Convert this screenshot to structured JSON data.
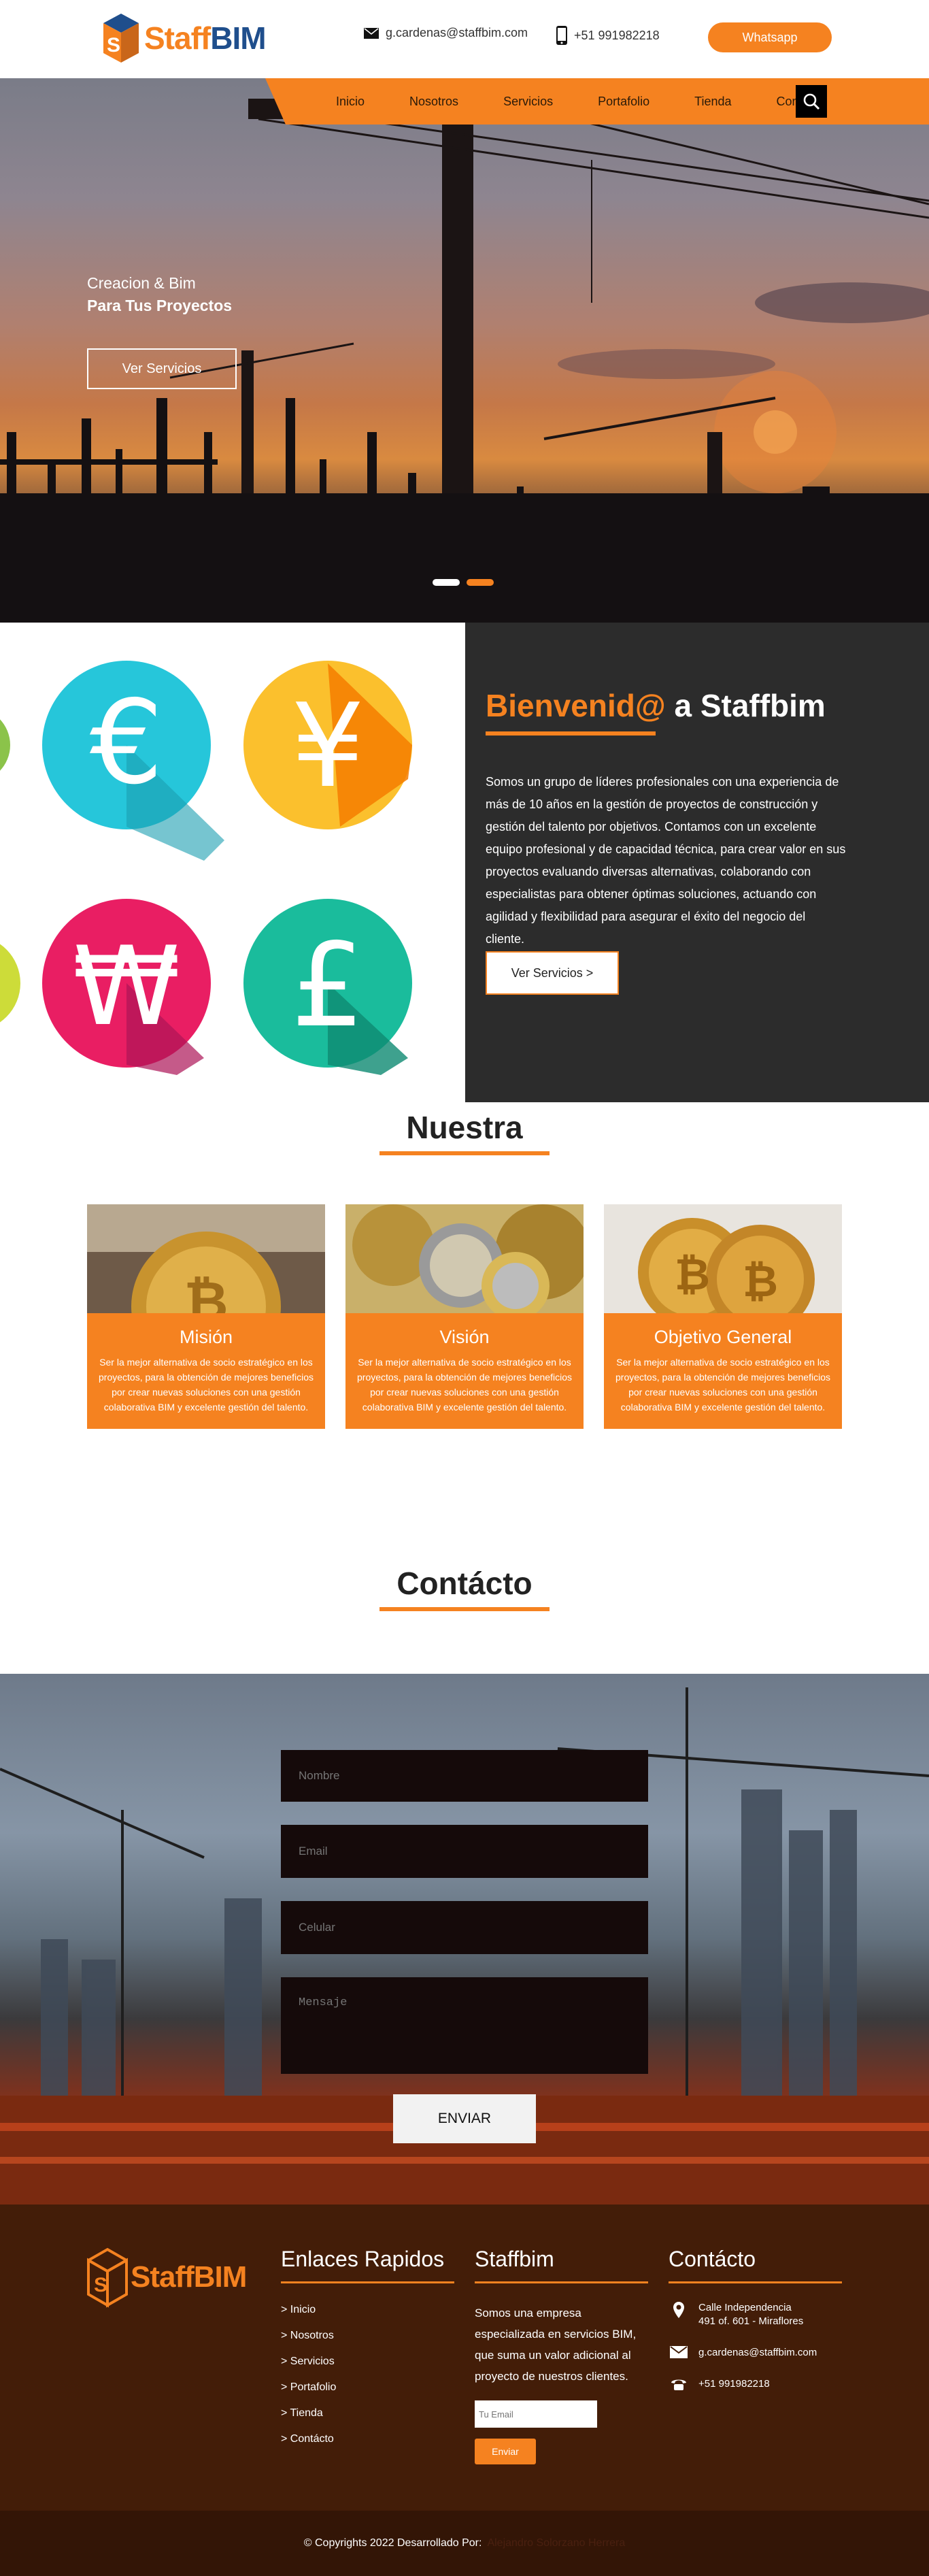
{
  "header": {
    "logo_staff": "Staff",
    "logo_bim": "BIM",
    "email": "g.cardenas@staffbim.com",
    "phone": "+51 991982218",
    "whatsapp_label": "Whatsapp"
  },
  "nav": {
    "items": [
      "Inicio",
      "Nosotros",
      "Servicios",
      "Portafolio",
      "Tienda",
      "Contácto"
    ],
    "search_icon": "search-icon"
  },
  "hero": {
    "line1": "Creacion & Bim",
    "line2": "Para Tus Proyectos",
    "button_label": "Ver Servicios",
    "slides": 2,
    "active_slide": 2
  },
  "welcome": {
    "title_highlight": "Bienvenid@",
    "title_rest": " a Staffbim",
    "body": "Somos un grupo de líderes profesionales con una experiencia de más de 10 años en la gestión de proyectos de construcción y gestión del talento por objetivos. Contamos con un excelente equipo profesional y de capacidad técnica, para crear valor en sus proyectos evaluando diversas alternativas, colaborando con especialistas para obtener óptimas soluciones, actuando con agilidad y flexibilidad para asegurar el éxito del negocio del cliente.",
    "button_label": "Ver Servicios >",
    "currency_icons": [
      "euro-icon",
      "yen-icon",
      "won-icon",
      "pound-icon"
    ]
  },
  "nuestra": {
    "title": "Nuestra",
    "cards": [
      {
        "title": "Misión",
        "text": "Ser la mejor alternativa de socio estratégico en los proyectos, para la obtención de mejores beneficios por crear nuevas soluciones con una gestión colaborativa BIM y excelente gestión del talento."
      },
      {
        "title": "Visión",
        "text": "Ser la mejor alternativa de socio estratégico en los proyectos, para la obtención de mejores beneficios por crear nuevas soluciones con una gestión colaborativa BIM y excelente gestión del talento."
      },
      {
        "title": "Objetivo General",
        "text": "Ser la mejor alternativa de socio estratégico en los proyectos, para la obtención de mejores beneficios por crear nuevas soluciones con una gestión colaborativa BIM y excelente gestión del talento."
      }
    ]
  },
  "contacto": {
    "title": "Contácto",
    "placeholders": {
      "name": "Nombre",
      "email": "Email",
      "phone": "Celular",
      "message": "Mensaje"
    },
    "send_label": "ENVIAR"
  },
  "footer": {
    "col1_title": "Enlaces Rapidos",
    "links": [
      "> Inicio",
      "> Nosotros",
      "> Servicios",
      "> Portafolio",
      "> Tienda",
      "> Contácto"
    ],
    "col2_title": "Staffbim",
    "col2_text": "Somos una empresa especializada en servicios BIM, que suma un valor adicional al proyecto de nuestros clientes.",
    "news_placeholder": "Tu Email",
    "news_button": "Enviar",
    "col3_title": "Contácto",
    "address_line1": "Calle Independencia",
    "address_line2": "491 of. 601 - Miraflores",
    "email": "g.cardenas@staffbim.com",
    "phone": "+51 991982218",
    "copyright": "© Copyrights 2022 Desarrollado Por:",
    "developer": "Alejandro Solorzano Herrera"
  },
  "colors": {
    "accent": "#f58220",
    "dark": "#2c2c2c",
    "footer": "#431d08",
    "bim_blue": "#1f4e8c"
  }
}
